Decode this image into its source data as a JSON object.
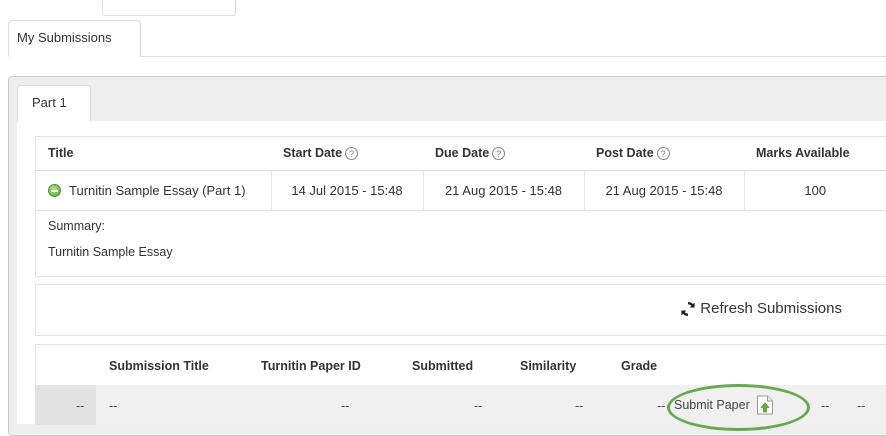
{
  "tabs": {
    "my_submissions": "My Submissions"
  },
  "parts": {
    "part1": "Part 1"
  },
  "assignment": {
    "headers": {
      "title": "Title",
      "start_date": "Start Date",
      "due_date": "Due Date",
      "post_date": "Post Date",
      "marks_available": "Marks Available"
    },
    "help_glyph": "?",
    "row": {
      "title": "Turnitin Sample Essay (Part 1)",
      "start_date": "14 Jul 2015 - 15:48",
      "due_date": "21 Aug 2015 - 15:48",
      "post_date": "21 Aug 2015 - 15:48",
      "marks_available": "100"
    },
    "summary_label": "Summary:",
    "summary_text": "Turnitin Sample Essay"
  },
  "refresh": {
    "label": "Refresh Submissions"
  },
  "submissions": {
    "headers": {
      "submission_title": "Submission Title",
      "paper_id": "Turnitin Paper ID",
      "submitted": "Submitted",
      "similarity": "Similarity",
      "grade": "Grade"
    },
    "row": {
      "index": "--",
      "submission_title": "--",
      "paper_id": "--",
      "submitted": "--",
      "similarity": "--",
      "grade": "--",
      "submit_label": "Submit Paper",
      "after1": "--",
      "after2": "--"
    }
  },
  "colors": {
    "highlight": "#6aa84f",
    "status": "#5aa630"
  },
  "icons": [
    "help-circle-icon",
    "status-circle-icon",
    "refresh-icon",
    "upload-document-icon"
  ]
}
